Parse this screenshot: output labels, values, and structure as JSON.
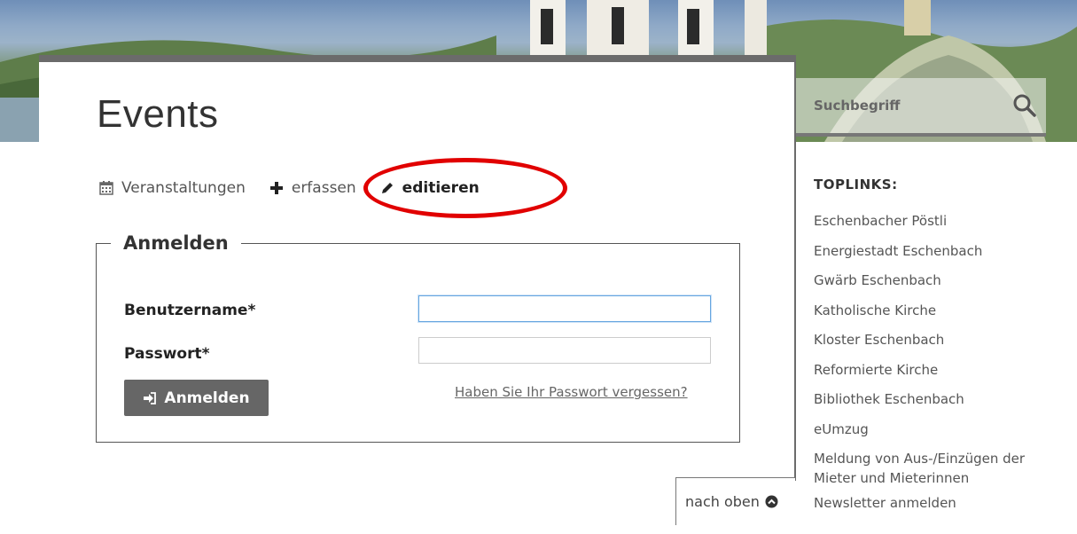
{
  "page": {
    "title": "Events"
  },
  "tabs": [
    {
      "label": "Veranstaltungen",
      "icon": "calendar-icon"
    },
    {
      "label": "erfassen",
      "icon": "plus-icon"
    },
    {
      "label": "editieren",
      "icon": "pencil-icon"
    }
  ],
  "login": {
    "legend": "Anmelden",
    "username_label": "Benutzername*",
    "username_value": "",
    "password_label": "Passwort*",
    "password_value": "",
    "submit_label": "Anmelden",
    "submit_icon": "sign-in-icon",
    "forgot_link": "Haben Sie Ihr Passwort vergessen?"
  },
  "search": {
    "placeholder": "Suchbegriff",
    "icon": "search-icon"
  },
  "toplinks": {
    "title": "TOPLINKS:",
    "items": [
      "Eschenbacher Pöstli",
      "Energiestadt Eschenbach",
      "Gwärb Eschenbach",
      "Katholische Kirche",
      "Kloster Eschenbach",
      "Reformierte Kirche",
      "Bibliothek Eschenbach",
      "eUmzug",
      "Meldung von Aus-/Einzügen der Mieter und Mieterinnen",
      "Newsletter anmelden"
    ]
  },
  "back_to_top": {
    "label": "nach oben",
    "icon": "circle-chevron-up-icon"
  },
  "colors": {
    "annotation_red": "#e10000",
    "button_gray": "#666666",
    "accent_border": "#6b6b6b"
  }
}
